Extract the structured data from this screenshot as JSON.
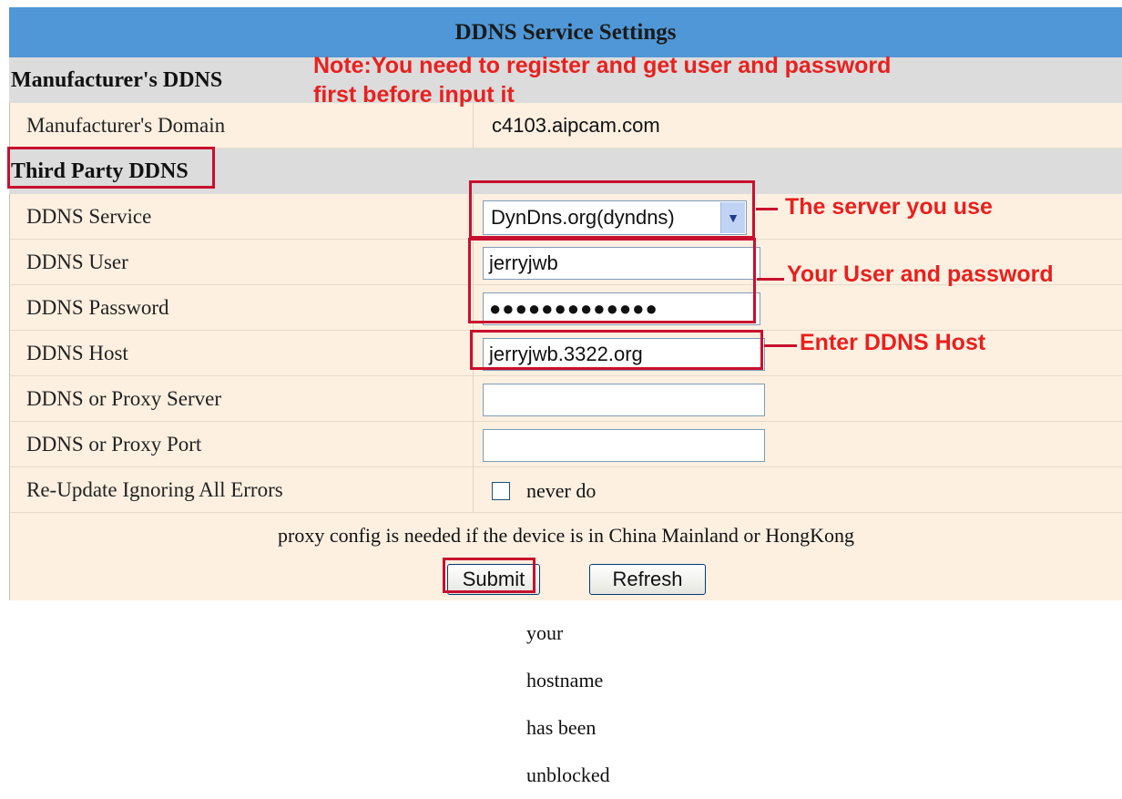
{
  "header": {
    "title": "DDNS Service Settings"
  },
  "manufacturer": {
    "section_title": "Manufacturer's DDNS",
    "domain_label": "Manufacturer's Domain",
    "domain_value": "c4103.aipcam.com"
  },
  "third_party": {
    "section_title": "Third Party DDNS",
    "service_label": "DDNS Service",
    "service_value": "DynDns.org(dyndns)",
    "user_label": "DDNS User",
    "user_value": "jerryjwb",
    "password_label": "DDNS Password",
    "password_value": "●●●●●●●●●●●●●",
    "host_label": "DDNS Host",
    "host_value": "jerryjwb.3322.org",
    "proxy_server_label": "DDNS or Proxy Server",
    "proxy_server_value": "",
    "proxy_port_label": "DDNS or Proxy Port",
    "proxy_port_value": "",
    "reupdate_label": "Re-Update Ignoring All Errors",
    "reupdate_checkbox_text": "never do this unless your hostname has been unblocked",
    "reupdate_checked": false
  },
  "proxy_note": "proxy config is needed if the device is in China Mainland or HongKong",
  "buttons": {
    "submit": "Submit",
    "refresh": "Refresh"
  },
  "annotations": {
    "note_line1": "Note:You need to register and get user and password",
    "note_line2": "first before input it",
    "server_hint": "The server you use",
    "user_pass_hint": "Your User and password",
    "host_hint": "Enter DDNS Host",
    "color": "#e8201e"
  },
  "colors": {
    "header_bg": "#4f97d6",
    "row_bg": "#fdf0e1",
    "section_bg": "#dcdcdc",
    "highlight": "#c8102e"
  }
}
